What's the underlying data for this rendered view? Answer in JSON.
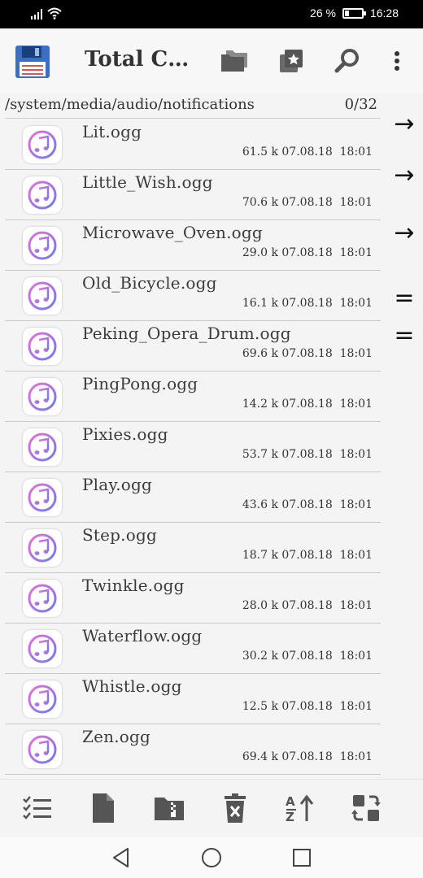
{
  "status_bar": {
    "battery_text": "26 %",
    "battery_level": 0.26,
    "time": "16:28"
  },
  "toolbar": {
    "title": "Total Co...",
    "icons": [
      "floppy-disk-icon",
      "folders-icon",
      "bookmark-star-icon",
      "search-icon",
      "more-vert-icon"
    ]
  },
  "path_bar": {
    "path": "/system/media/audio/notifications",
    "count": "0/32"
  },
  "files": [
    {
      "name": "Lit.ogg",
      "size": "61.5 k",
      "date": "07.08.18",
      "time": "18:01"
    },
    {
      "name": "Little_Wish.ogg",
      "size": "70.6 k",
      "date": "07.08.18",
      "time": "18:01"
    },
    {
      "name": "Microwave_Oven.ogg",
      "size": "29.0 k",
      "date": "07.08.18",
      "time": "18:01"
    },
    {
      "name": "Old_Bicycle.ogg",
      "size": "16.1 k",
      "date": "07.08.18",
      "time": "18:01"
    },
    {
      "name": "Peking_Opera_Drum.ogg",
      "size": "69.6 k",
      "date": "07.08.18",
      "time": "18:01"
    },
    {
      "name": "PingPong.ogg",
      "size": "14.2 k",
      "date": "07.08.18",
      "time": "18:01"
    },
    {
      "name": "Pixies.ogg",
      "size": "53.7 k",
      "date": "07.08.18",
      "time": "18:01"
    },
    {
      "name": "Play.ogg",
      "size": "43.6 k",
      "date": "07.08.18",
      "time": "18:01"
    },
    {
      "name": "Step.ogg",
      "size": "18.7 k",
      "date": "07.08.18",
      "time": "18:01"
    },
    {
      "name": "Twinkle.ogg",
      "size": "28.0 k",
      "date": "07.08.18",
      "time": "18:01"
    },
    {
      "name": "Waterflow.ogg",
      "size": "30.2 k",
      "date": "07.08.18",
      "time": "18:01"
    },
    {
      "name": "Whistle.ogg",
      "size": "12.5 k",
      "date": "07.08.18",
      "time": "18:01"
    },
    {
      "name": "Zen.ogg",
      "size": "69.4 k",
      "date": "07.08.18",
      "time": "18:01"
    }
  ],
  "side_markers": [
    "→",
    "→",
    "→",
    "=",
    "="
  ],
  "bottom_bar": [
    "select-list-icon",
    "new-file-icon",
    "zip-folder-icon",
    "delete-icon",
    "sort-az-icon",
    "swap-panels-icon"
  ],
  "nav_bar": [
    "back-icon",
    "home-icon",
    "recents-icon"
  ],
  "colors": {
    "status_bar": "#000000",
    "music_gradient_start": "#e86fd6",
    "music_gradient_end": "#6a7cf0",
    "floppy_blue": "#3a6fc4"
  }
}
